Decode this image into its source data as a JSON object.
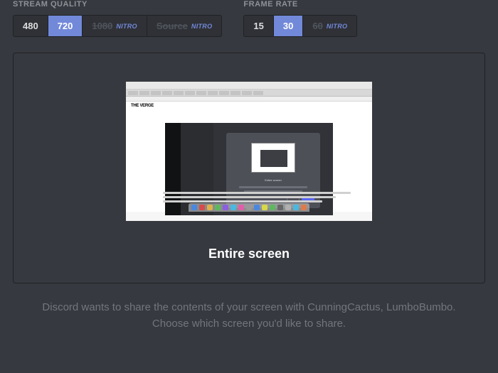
{
  "settings": {
    "quality": {
      "label": "STREAM QUALITY",
      "options": [
        {
          "value": "480",
          "nitro": false,
          "active": false
        },
        {
          "value": "720",
          "nitro": false,
          "active": true
        },
        {
          "value": "1080",
          "nitro": true,
          "active": false
        },
        {
          "value": "Source",
          "nitro": true,
          "active": false
        }
      ]
    },
    "framerate": {
      "label": "FRAME RATE",
      "options": [
        {
          "value": "15",
          "nitro": false,
          "active": false
        },
        {
          "value": "30",
          "nitro": false,
          "active": true
        },
        {
          "value": "60",
          "nitro": true,
          "active": false
        }
      ]
    },
    "nitro_badge": "NITRO"
  },
  "preview": {
    "caption": "Entire screen"
  },
  "footer": {
    "line1": "Discord wants to share the contents of your screen with CunningCactus, LumboBumbo.",
    "line2": "Choose which screen you'd like to share."
  }
}
